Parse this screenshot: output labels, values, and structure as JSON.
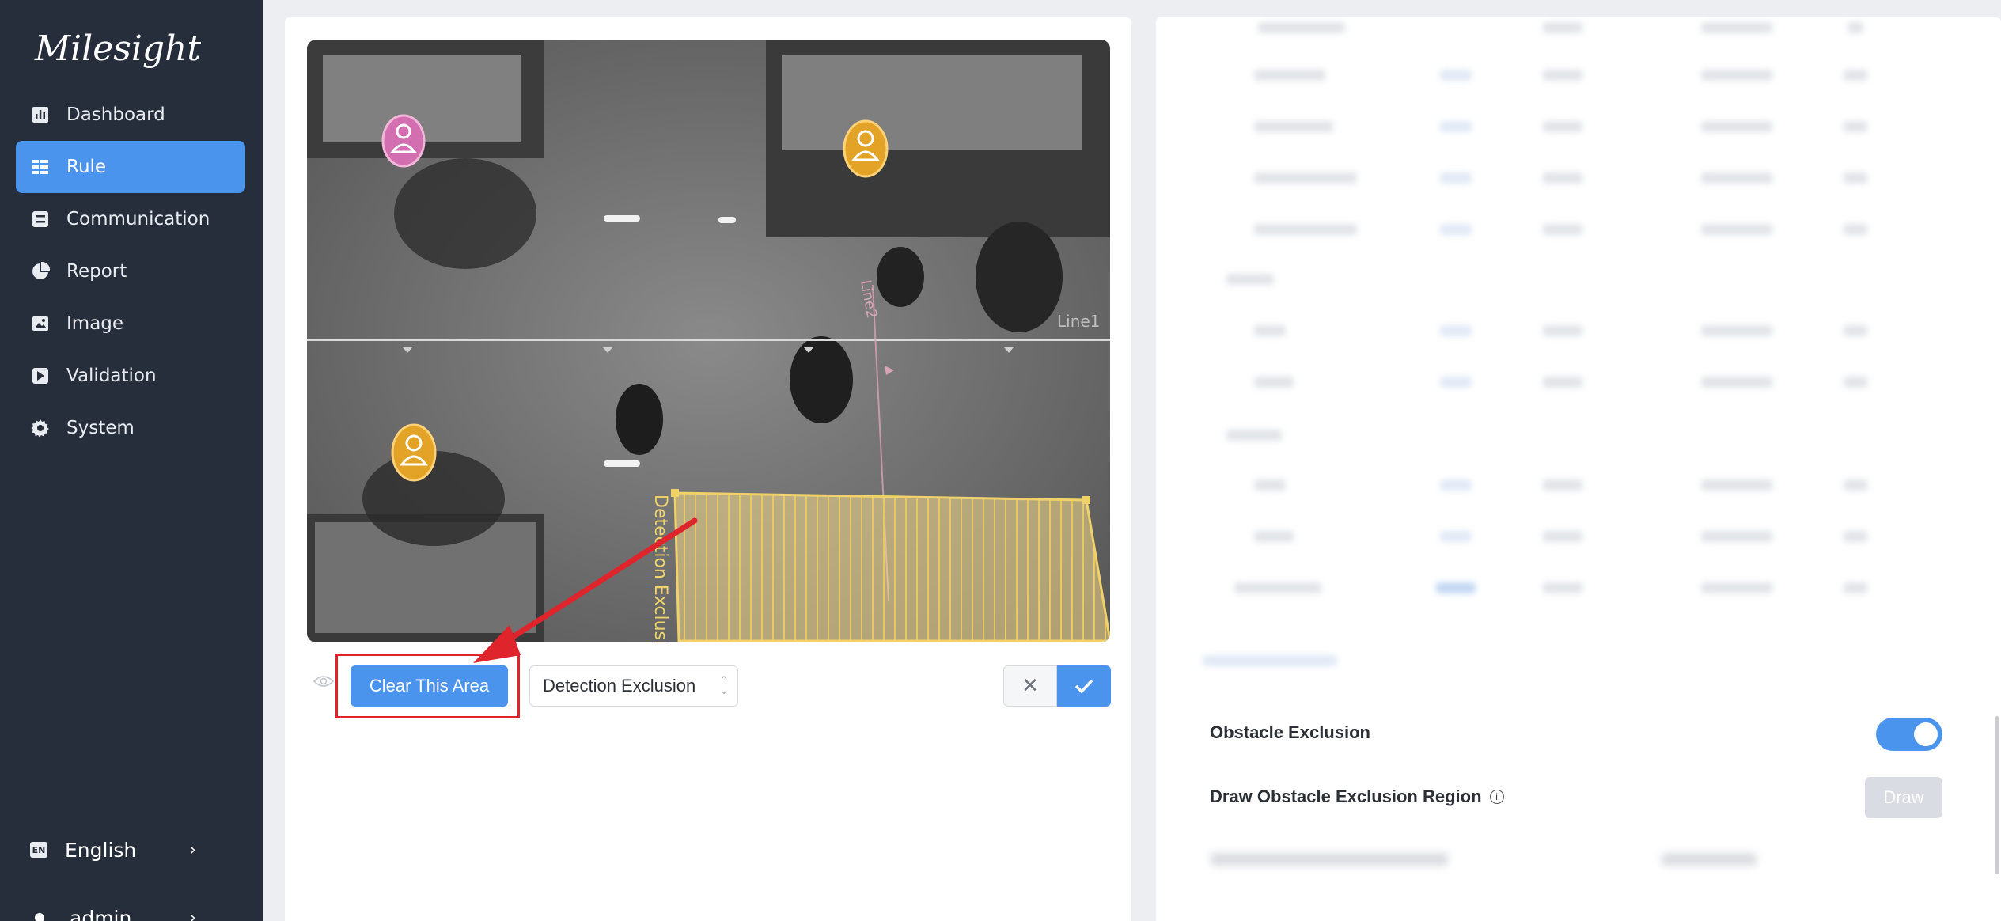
{
  "app": {
    "brand": "Milesight"
  },
  "sidebar": {
    "items": [
      {
        "label": "Dashboard",
        "icon": "dashboard-icon",
        "active": false
      },
      {
        "label": "Rule",
        "icon": "rule-icon",
        "active": true
      },
      {
        "label": "Communication",
        "icon": "communication-icon",
        "active": false
      },
      {
        "label": "Report",
        "icon": "report-icon",
        "active": false
      },
      {
        "label": "Image",
        "icon": "image-icon",
        "active": false
      },
      {
        "label": "Validation",
        "icon": "validation-icon",
        "active": false
      },
      {
        "label": "System",
        "icon": "gear-icon",
        "active": false
      }
    ],
    "language": {
      "badge": "EN",
      "label": "English"
    },
    "user": {
      "label": "admin"
    }
  },
  "editor": {
    "video_labels": {
      "line1": "Line1",
      "line2": "Line2",
      "region": "Detection Exclusion"
    },
    "clear_button": "Clear This Area",
    "region_type_select": "Detection Exclusion"
  },
  "settings": {
    "obstacle_exclusion": {
      "label": "Obstacle Exclusion",
      "enabled": true
    },
    "draw_region": {
      "label": "Draw Obstacle Exclusion Region",
      "button": "Draw"
    }
  },
  "colors": {
    "sidebar_bg": "#262d3b",
    "accent": "#4a94ee",
    "highlight": "#e0242c",
    "region_fill": "#f5dd8a"
  }
}
